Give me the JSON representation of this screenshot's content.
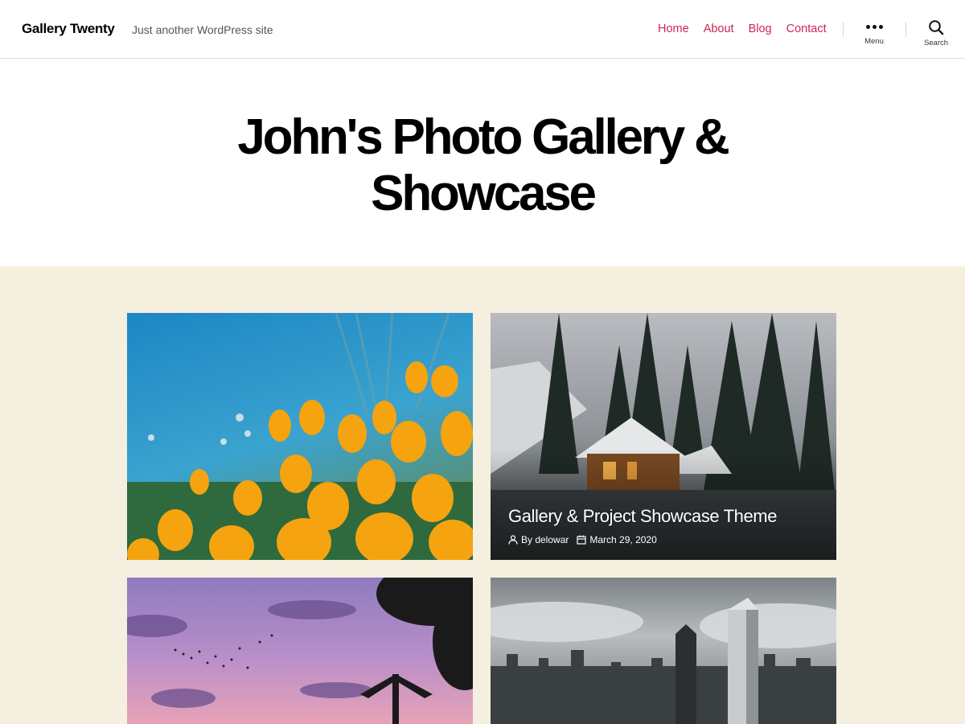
{
  "header": {
    "site_title": "Gallery Twenty",
    "site_description": "Just another WordPress site",
    "nav": [
      "Home",
      "About",
      "Blog",
      "Contact"
    ],
    "menu_label": "Menu",
    "search_label": "Search"
  },
  "hero": {
    "title": "John's Photo Gallery & Showcase"
  },
  "posts": [
    {
      "title": "",
      "author": "",
      "date": ""
    },
    {
      "title": "Gallery & Project Showcase Theme",
      "author": "By delowar",
      "date": "March 29, 2020"
    },
    {
      "title": "",
      "author": "",
      "date": ""
    },
    {
      "title": "",
      "author": "",
      "date": ""
    }
  ],
  "colors": {
    "accent": "#cd2653",
    "background_band": "#f5efe0"
  },
  "icons": [
    "menu-dots-icon",
    "search-icon",
    "author-icon",
    "calendar-icon"
  ]
}
